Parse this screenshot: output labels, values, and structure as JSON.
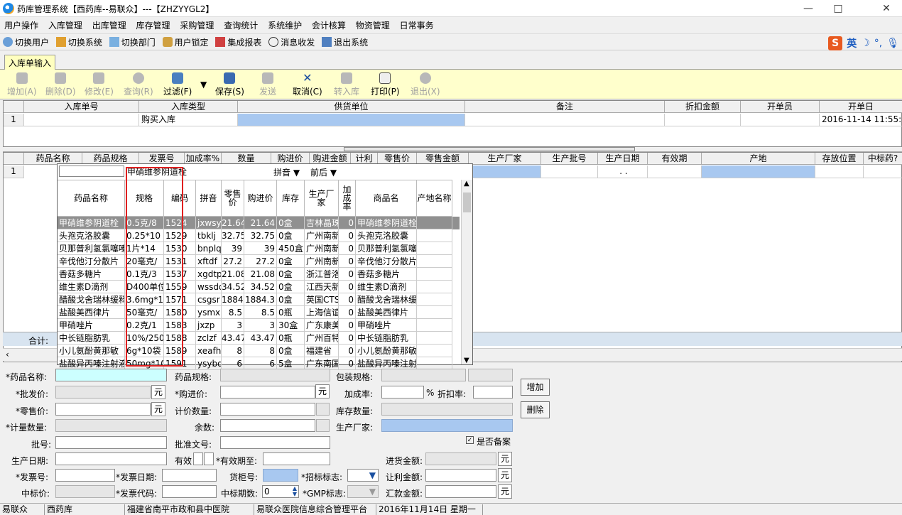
{
  "window": {
    "title": "药库管理系统【西药库--易联众】---【ZHZYYGL2】"
  },
  "menu": [
    "用户操作",
    "入库管理",
    "出库管理",
    "库存管理",
    "采购管理",
    "查询统计",
    "系统维护",
    "会计核算",
    "物资管理",
    "日常事务"
  ],
  "toolbar": [
    "切换用户",
    "切换系统",
    "切换部门",
    "用户锁定",
    "集成报表",
    "消息收发",
    "退出系统"
  ],
  "ime": {
    "label": "英"
  },
  "tab": {
    "label": "入库单输入"
  },
  "actions": {
    "add": "增加(A)",
    "delete": "删除(D)",
    "edit": "修改(E)",
    "query": "查询(R)",
    "filter": "过滤(F)",
    "save": "保存(S)",
    "send": "发送",
    "cancel": "取消(C)",
    "transfer": "转入库",
    "print": "打印(P)",
    "exit": "退出(X)"
  },
  "header_grid": {
    "columns": [
      "入库单号",
      "入库类型",
      "供货单位",
      "备注",
      "折扣金额",
      "开单员",
      "开单日"
    ],
    "row": {
      "index": "1",
      "type": "购买入库",
      "date": "2016-11-14 11:55:"
    }
  },
  "detail_grid": {
    "columns": [
      "药品名称",
      "药品规格",
      "发票号",
      "加成率%",
      "数量",
      "购进价",
      "购进金额",
      "计利",
      "零售价",
      "零售金额",
      "生产厂家",
      "生产批号",
      "生产日期",
      "有效期",
      "产地",
      "存放位置",
      "中标药?"
    ],
    "row_index": "1",
    "date_placeholder": ". .",
    "total_label": "合计:"
  },
  "popup": {
    "search_text": "甲硝维参阴道栓",
    "filter1": "拼音",
    "filter2": "前后",
    "columns": [
      "药品名称",
      "规格",
      "编码",
      "拼音",
      "零售价",
      "购进价",
      "库存",
      "生产厂家",
      "加成率",
      "商品名",
      "产地名称"
    ],
    "rows": [
      [
        "甲硝维参阴道栓",
        "0.5克/8",
        "1524",
        "jxwsy",
        "21.64",
        "21.64",
        "0盒",
        "吉林晶珠",
        "0",
        "甲硝维参阴道栓"
      ],
      [
        "头孢克洛胶囊",
        "0.25*10",
        "1529",
        "tbklj",
        "32.75",
        "32.75",
        "0盒",
        "广州南新",
        "0",
        "头孢克洛胶囊"
      ],
      [
        "贝那普利氢氯噻嗪",
        "1片*14",
        "1530",
        "bnplq",
        "39",
        "39",
        "450盒",
        "广州南新",
        "0",
        "贝那普利氢氯噻"
      ],
      [
        "辛伐他汀分散片",
        "20毫克/",
        "1531",
        "xftdf",
        "27.2",
        "27.2",
        "0盒",
        "广州南新",
        "0",
        "辛伐他汀分散片"
      ],
      [
        "香菇多糖片",
        "0.1克/3",
        "1537",
        "xgdtp",
        "21.08",
        "21.08",
        "0盒",
        "浙江普洛",
        "0",
        "香菇多糖片"
      ],
      [
        "维生素D滴剂",
        "D400单位",
        "1559",
        "wssdd",
        "34.52",
        "34.52",
        "0盒",
        "江西天新",
        "0",
        "维生素D滴剂"
      ],
      [
        "醋酸戈舍瑞林缓释",
        "3.6mg*1",
        "1571",
        "csgsr",
        "1884.3",
        "1884.3",
        "0盒",
        "英国CTS",
        "0",
        "醋酸戈舍瑞林缓"
      ],
      [
        "盐酸美西律片",
        "50毫克/",
        "1580",
        "ysmxl",
        "8.5",
        "8.5",
        "0瓶",
        "上海信谊",
        "0",
        "盐酸美西律片"
      ],
      [
        "甲硝唑片",
        "0.2克/1",
        "1583",
        "jxzp",
        "3",
        "3",
        "30盒",
        "广东康美",
        "0",
        "甲硝唑片"
      ],
      [
        "中长链脂肪乳",
        "10%/250",
        "1588",
        "zclzf",
        "43.47",
        "43.47",
        "0瓶",
        "广州百特",
        "0",
        "中长链脂肪乳"
      ],
      [
        "小儿氨酚黄那敏",
        "6g*10袋",
        "1589",
        "xeafh",
        "8",
        "8",
        "0盒",
        "福建省",
        "0",
        "小儿氨酚黄那敏"
      ],
      [
        "盐酸异丙嗪注射液",
        "50mg*10",
        "1591",
        "ysybq",
        "6",
        "6",
        "5盒",
        "广东南国",
        "0",
        "盐酸异丙嗪注射"
      ]
    ]
  },
  "form": {
    "drug_name": "*药品名称:",
    "spec": "药品规格:",
    "pack_spec": "包装规格:",
    "wholesale": "*批发价:",
    "purchase": "*购进价:",
    "markup": "加成率:",
    "discount": "折扣率:",
    "retail": "*零售价:",
    "count_qty": "计价数量:",
    "stock_qty": "库存数量:",
    "measure_qty": "*计量数量:",
    "remainder": "余数:",
    "manufacturer": "生产厂家:",
    "batch": "批号:",
    "approval": "批准文号:",
    "registered": "是否备案",
    "prod_date": "生产日期:",
    "validity": "有效",
    "valid_until": "*有效期至:",
    "purchase_amount": "进货金额:",
    "invoice_no": "*发票号:",
    "invoice_date": "*发票日期:",
    "cabinet": "货柜号:",
    "bid_flag": "*招标标志:",
    "profit_amount": "让利金额:",
    "bid_price": "中标价:",
    "invoice_code": "*发票代码:",
    "bid_period": "中标期数:",
    "bid_period_value": "0",
    "gmp_flag": "*GMP标志:",
    "remit_amount": "汇款金额:",
    "yuan": "元",
    "percent": "%",
    "add_button": "增加",
    "delete_button": "删除"
  },
  "status": [
    "易联众",
    "西药库",
    "福建省南平市政和县中医院",
    "易联众医院信息综合管理平台",
    "2016年11月14日 星期一"
  ]
}
